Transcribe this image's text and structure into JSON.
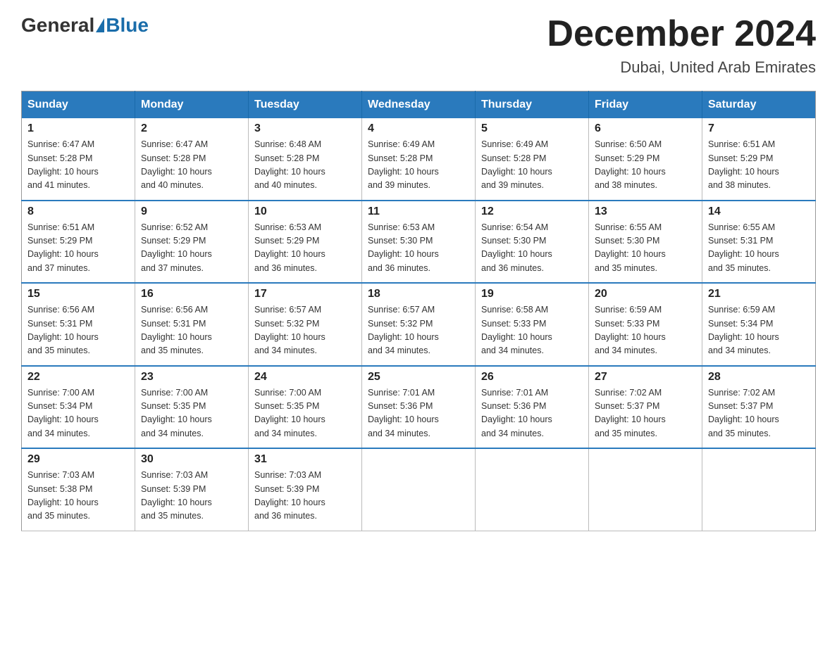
{
  "logo": {
    "general": "General",
    "blue": "Blue"
  },
  "title": {
    "month_year": "December 2024",
    "location": "Dubai, United Arab Emirates"
  },
  "days_of_week": [
    "Sunday",
    "Monday",
    "Tuesday",
    "Wednesday",
    "Thursday",
    "Friday",
    "Saturday"
  ],
  "weeks": [
    [
      {
        "day": "1",
        "info": "Sunrise: 6:47 AM\nSunset: 5:28 PM\nDaylight: 10 hours\nand 41 minutes."
      },
      {
        "day": "2",
        "info": "Sunrise: 6:47 AM\nSunset: 5:28 PM\nDaylight: 10 hours\nand 40 minutes."
      },
      {
        "day": "3",
        "info": "Sunrise: 6:48 AM\nSunset: 5:28 PM\nDaylight: 10 hours\nand 40 minutes."
      },
      {
        "day": "4",
        "info": "Sunrise: 6:49 AM\nSunset: 5:28 PM\nDaylight: 10 hours\nand 39 minutes."
      },
      {
        "day": "5",
        "info": "Sunrise: 6:49 AM\nSunset: 5:28 PM\nDaylight: 10 hours\nand 39 minutes."
      },
      {
        "day": "6",
        "info": "Sunrise: 6:50 AM\nSunset: 5:29 PM\nDaylight: 10 hours\nand 38 minutes."
      },
      {
        "day": "7",
        "info": "Sunrise: 6:51 AM\nSunset: 5:29 PM\nDaylight: 10 hours\nand 38 minutes."
      }
    ],
    [
      {
        "day": "8",
        "info": "Sunrise: 6:51 AM\nSunset: 5:29 PM\nDaylight: 10 hours\nand 37 minutes."
      },
      {
        "day": "9",
        "info": "Sunrise: 6:52 AM\nSunset: 5:29 PM\nDaylight: 10 hours\nand 37 minutes."
      },
      {
        "day": "10",
        "info": "Sunrise: 6:53 AM\nSunset: 5:29 PM\nDaylight: 10 hours\nand 36 minutes."
      },
      {
        "day": "11",
        "info": "Sunrise: 6:53 AM\nSunset: 5:30 PM\nDaylight: 10 hours\nand 36 minutes."
      },
      {
        "day": "12",
        "info": "Sunrise: 6:54 AM\nSunset: 5:30 PM\nDaylight: 10 hours\nand 36 minutes."
      },
      {
        "day": "13",
        "info": "Sunrise: 6:55 AM\nSunset: 5:30 PM\nDaylight: 10 hours\nand 35 minutes."
      },
      {
        "day": "14",
        "info": "Sunrise: 6:55 AM\nSunset: 5:31 PM\nDaylight: 10 hours\nand 35 minutes."
      }
    ],
    [
      {
        "day": "15",
        "info": "Sunrise: 6:56 AM\nSunset: 5:31 PM\nDaylight: 10 hours\nand 35 minutes."
      },
      {
        "day": "16",
        "info": "Sunrise: 6:56 AM\nSunset: 5:31 PM\nDaylight: 10 hours\nand 35 minutes."
      },
      {
        "day": "17",
        "info": "Sunrise: 6:57 AM\nSunset: 5:32 PM\nDaylight: 10 hours\nand 34 minutes."
      },
      {
        "day": "18",
        "info": "Sunrise: 6:57 AM\nSunset: 5:32 PM\nDaylight: 10 hours\nand 34 minutes."
      },
      {
        "day": "19",
        "info": "Sunrise: 6:58 AM\nSunset: 5:33 PM\nDaylight: 10 hours\nand 34 minutes."
      },
      {
        "day": "20",
        "info": "Sunrise: 6:59 AM\nSunset: 5:33 PM\nDaylight: 10 hours\nand 34 minutes."
      },
      {
        "day": "21",
        "info": "Sunrise: 6:59 AM\nSunset: 5:34 PM\nDaylight: 10 hours\nand 34 minutes."
      }
    ],
    [
      {
        "day": "22",
        "info": "Sunrise: 7:00 AM\nSunset: 5:34 PM\nDaylight: 10 hours\nand 34 minutes."
      },
      {
        "day": "23",
        "info": "Sunrise: 7:00 AM\nSunset: 5:35 PM\nDaylight: 10 hours\nand 34 minutes."
      },
      {
        "day": "24",
        "info": "Sunrise: 7:00 AM\nSunset: 5:35 PM\nDaylight: 10 hours\nand 34 minutes."
      },
      {
        "day": "25",
        "info": "Sunrise: 7:01 AM\nSunset: 5:36 PM\nDaylight: 10 hours\nand 34 minutes."
      },
      {
        "day": "26",
        "info": "Sunrise: 7:01 AM\nSunset: 5:36 PM\nDaylight: 10 hours\nand 34 minutes."
      },
      {
        "day": "27",
        "info": "Sunrise: 7:02 AM\nSunset: 5:37 PM\nDaylight: 10 hours\nand 35 minutes."
      },
      {
        "day": "28",
        "info": "Sunrise: 7:02 AM\nSunset: 5:37 PM\nDaylight: 10 hours\nand 35 minutes."
      }
    ],
    [
      {
        "day": "29",
        "info": "Sunrise: 7:03 AM\nSunset: 5:38 PM\nDaylight: 10 hours\nand 35 minutes."
      },
      {
        "day": "30",
        "info": "Sunrise: 7:03 AM\nSunset: 5:39 PM\nDaylight: 10 hours\nand 35 minutes."
      },
      {
        "day": "31",
        "info": "Sunrise: 7:03 AM\nSunset: 5:39 PM\nDaylight: 10 hours\nand 36 minutes."
      },
      {
        "day": "",
        "info": ""
      },
      {
        "day": "",
        "info": ""
      },
      {
        "day": "",
        "info": ""
      },
      {
        "day": "",
        "info": ""
      }
    ]
  ]
}
